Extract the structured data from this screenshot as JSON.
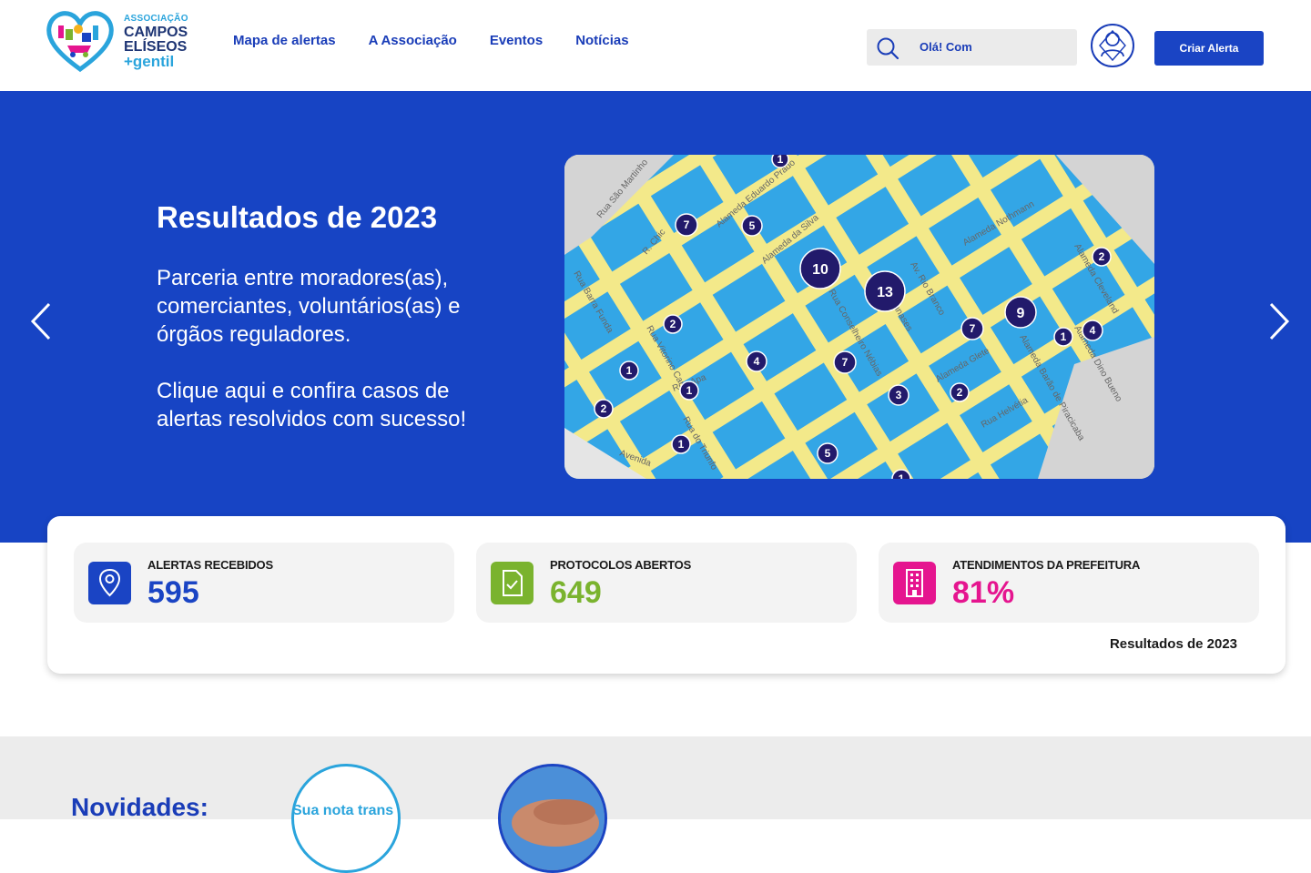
{
  "brand": {
    "line1": "ASSOCIAÇÃO",
    "line2": "CAMPOS",
    "line3": "ELÍSEOS",
    "line4": "+gentil"
  },
  "nav": {
    "items": [
      {
        "label": "Mapa de alertas"
      },
      {
        "label": "A Associação"
      },
      {
        "label": "Eventos"
      },
      {
        "label": "Notícias"
      }
    ]
  },
  "search": {
    "text": "Olá! Com",
    "icon": "search-icon"
  },
  "header": {
    "cta_label": "Criar Alerta",
    "avatar_icon": "user-avatar-icon"
  },
  "hero": {
    "title": "Resultados de 2023",
    "paragraph1": "Parceria entre moradores(as), comerciantes, voluntários(as) e órgãos reguladores.",
    "paragraph2": "Clique aqui e confira casos de alertas resolvidos com sucesso!",
    "prev_icon": "chevron-left-icon",
    "next_icon": "chevron-right-icon"
  },
  "map": {
    "streets": [
      "Rua São Martinho",
      "R. Chic",
      "Alameda Eduardo Prado",
      "Alameda Nothmann",
      "Alameda Cleveland",
      "Av. Rio Branco",
      "Rua Conselheiro Nébias",
      "Alameda Barão de Piracicaba",
      "Rua Helvétia",
      "Alameda Glete",
      "Rua Barra Funda",
      "Rua Vitorino Camilo",
      "Rua Guaianases",
      "Alameda Dino Bueno",
      "Avenida",
      "Rua Apa",
      "Rua do Triunfo",
      "Alameda da Silva"
    ],
    "markers": [
      "1",
      "7",
      "5",
      "10",
      "13",
      "2",
      "9",
      "7",
      "4",
      "1",
      "2",
      "4",
      "7",
      "1",
      "1",
      "3",
      "2",
      "2",
      "1",
      "5",
      "1"
    ]
  },
  "stats": {
    "items": [
      {
        "label": "ALERTAS RECEBIDOS",
        "value": "595",
        "icon": "map-pin-icon",
        "color": "#1a44c4"
      },
      {
        "label": "PROTOCOLOS ABERTOS",
        "value": "649",
        "icon": "clipboard-check-icon",
        "color": "#7ab32e"
      },
      {
        "label": "ATENDIMENTOS DA PREFEITURA",
        "value": "81%",
        "icon": "building-icon",
        "color": "#e5158f"
      }
    ],
    "footer": "Resultados de 2023"
  },
  "news": {
    "heading": "Novidades:",
    "card1_text": "Sua nota trans"
  }
}
